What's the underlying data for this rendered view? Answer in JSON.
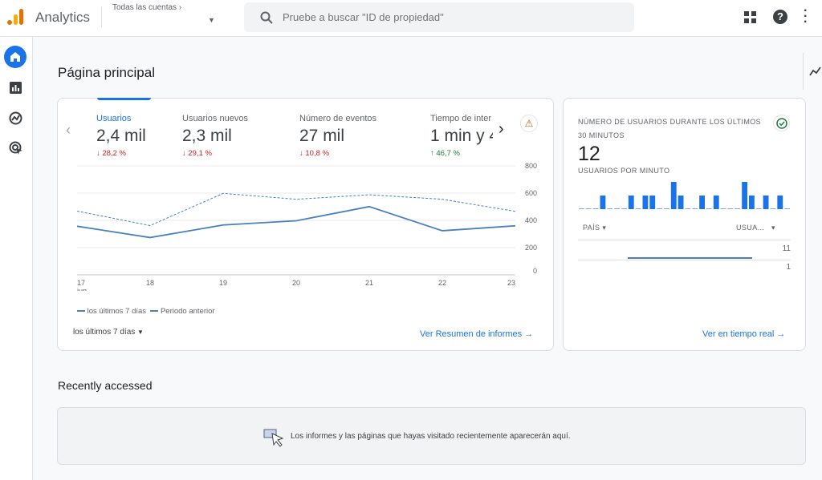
{
  "header": {
    "app_title": "Analytics",
    "account_breadcrumb": "Todas las cuentas",
    "search_placeholder": "Pruebe a buscar \"ID de propiedad\""
  },
  "sidebar": {
    "items": [
      {
        "icon": "home-icon",
        "active": true
      },
      {
        "icon": "reports-icon"
      },
      {
        "icon": "explore-icon"
      },
      {
        "icon": "advertising-icon"
      }
    ]
  },
  "page_title": "Página principal",
  "metrics": [
    {
      "label": "Usuarios",
      "value": "2,4 mil",
      "delta": "28,2 %",
      "direction": "down",
      "selected": true
    },
    {
      "label": "Usuarios nuevos",
      "value": "2,3 mil",
      "delta": "29,1 %",
      "direction": "down"
    },
    {
      "label": "Número de eventos",
      "value": "27 mil",
      "delta": "10,8 %",
      "direction": "down"
    },
    {
      "label": "Tiempo de inter",
      "value": "1 min y 4",
      "delta": "46,7 %",
      "direction": "up"
    }
  ],
  "chart_data": {
    "type": "line",
    "x": [
      "17",
      "18",
      "19",
      "20",
      "21",
      "22",
      "23"
    ],
    "x_sublabel": "jun",
    "ylim": [
      0,
      800
    ],
    "yticks": [
      0,
      200,
      400,
      600,
      800
    ],
    "grid": true,
    "legend_placement": "bottom-left",
    "series": [
      {
        "name": "los últimos 7 días",
        "style": "solid",
        "values": [
          357,
          274,
          366,
          397,
          501,
          324,
          360
        ]
      },
      {
        "name": "Periodo anterior",
        "style": "dashed",
        "values": [
          468,
          362,
          598,
          555,
          588,
          555,
          466
        ]
      }
    ]
  },
  "date_range": "los últimos 7 días",
  "report_link": "Ver Resumen de informes",
  "realtime": {
    "title": "NÚMERO DE USUARIOS DURANTE LOS ÚLTIMOS 30 MINUTOS",
    "value": "12",
    "subtitle": "USUARIOS POR MINUTO",
    "bars": [
      0,
      0,
      0,
      1,
      0,
      0,
      0,
      1,
      0,
      1,
      1,
      0,
      0,
      2,
      1,
      0,
      0,
      1,
      0,
      1,
      0,
      0,
      0,
      2,
      1,
      0,
      1,
      0,
      1,
      0
    ],
    "col_country": "PAÍS",
    "col_users": "USUA...",
    "rows": [
      {
        "country": "",
        "users": "11",
        "share": 0.82
      },
      {
        "country": "",
        "users": "1",
        "share": 0
      }
    ],
    "link": "Ver en tiempo real"
  },
  "recent": {
    "title": "Recently accessed",
    "empty_message": "Los informes y las páginas que hayas visitado recientemente aparecerán aquí."
  },
  "colors": {
    "accent": "#1a73e8",
    "line": "#4a7fc1",
    "bar": "#1a73e8",
    "down": "#c5221f",
    "up": "#188038",
    "logo_orange": "#f9ab00",
    "logo_dark": "#e37400"
  }
}
